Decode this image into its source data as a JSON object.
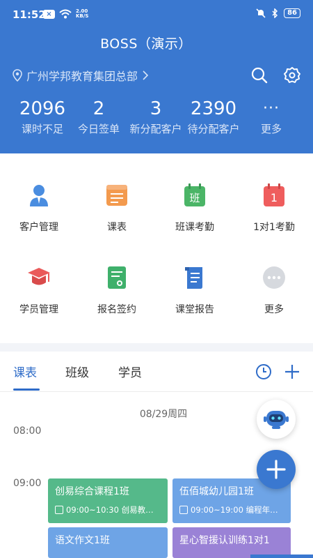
{
  "status_bar": {
    "time": "11:52",
    "net_speed_top": "2.00",
    "net_speed_bottom": "KB/S",
    "battery": "86"
  },
  "header": {
    "title": "BOSS（演示）",
    "org_name": "广州学邦教育集团总部",
    "stats": [
      {
        "value": "2096",
        "label": "课时不足"
      },
      {
        "value": "2",
        "label": "今日签单"
      },
      {
        "value": "3",
        "label": "新分配客户"
      },
      {
        "value": "2390",
        "label": "待分配客户"
      }
    ],
    "more_label": "更多"
  },
  "grid": {
    "items": [
      {
        "label": "客户管理",
        "icon": "customer-icon"
      },
      {
        "label": "课表",
        "icon": "schedule-icon"
      },
      {
        "label": "班课考勤",
        "icon": "class-attendance-icon",
        "badge": "班"
      },
      {
        "label": "1对1考勤",
        "icon": "one-on-one-icon",
        "badge": "1"
      },
      {
        "label": "学员管理",
        "icon": "student-icon"
      },
      {
        "label": "报名签约",
        "icon": "enroll-icon"
      },
      {
        "label": "课堂报告",
        "icon": "report-icon"
      },
      {
        "label": "更多",
        "icon": "more-icon"
      }
    ]
  },
  "tabs": [
    {
      "label": "课表",
      "active": true
    },
    {
      "label": "班级",
      "active": false
    },
    {
      "label": "学员",
      "active": false
    }
  ],
  "schedule": {
    "date": "08/29周四",
    "times": [
      "08:00",
      "09:00"
    ],
    "cards": [
      {
        "title": "创易综合课程1班",
        "sub": "09:00~10:30  创易教…",
        "color": "#55b98a"
      },
      {
        "title": "伍佰城幼儿园1班",
        "sub": "09:00~19:00  编程年…",
        "color": "#6ea4e6"
      },
      {
        "title": "语文作文1班",
        "sub": "",
        "color": "#6ea4e6"
      },
      {
        "title": "星心智援认训练1对1",
        "sub": "",
        "color": "#9a82d6"
      }
    ]
  },
  "colors": {
    "primary": "#3a78d0",
    "green_card": "#55b98a",
    "blue_card": "#6ea4e6",
    "purple_card": "#9a82d6"
  }
}
